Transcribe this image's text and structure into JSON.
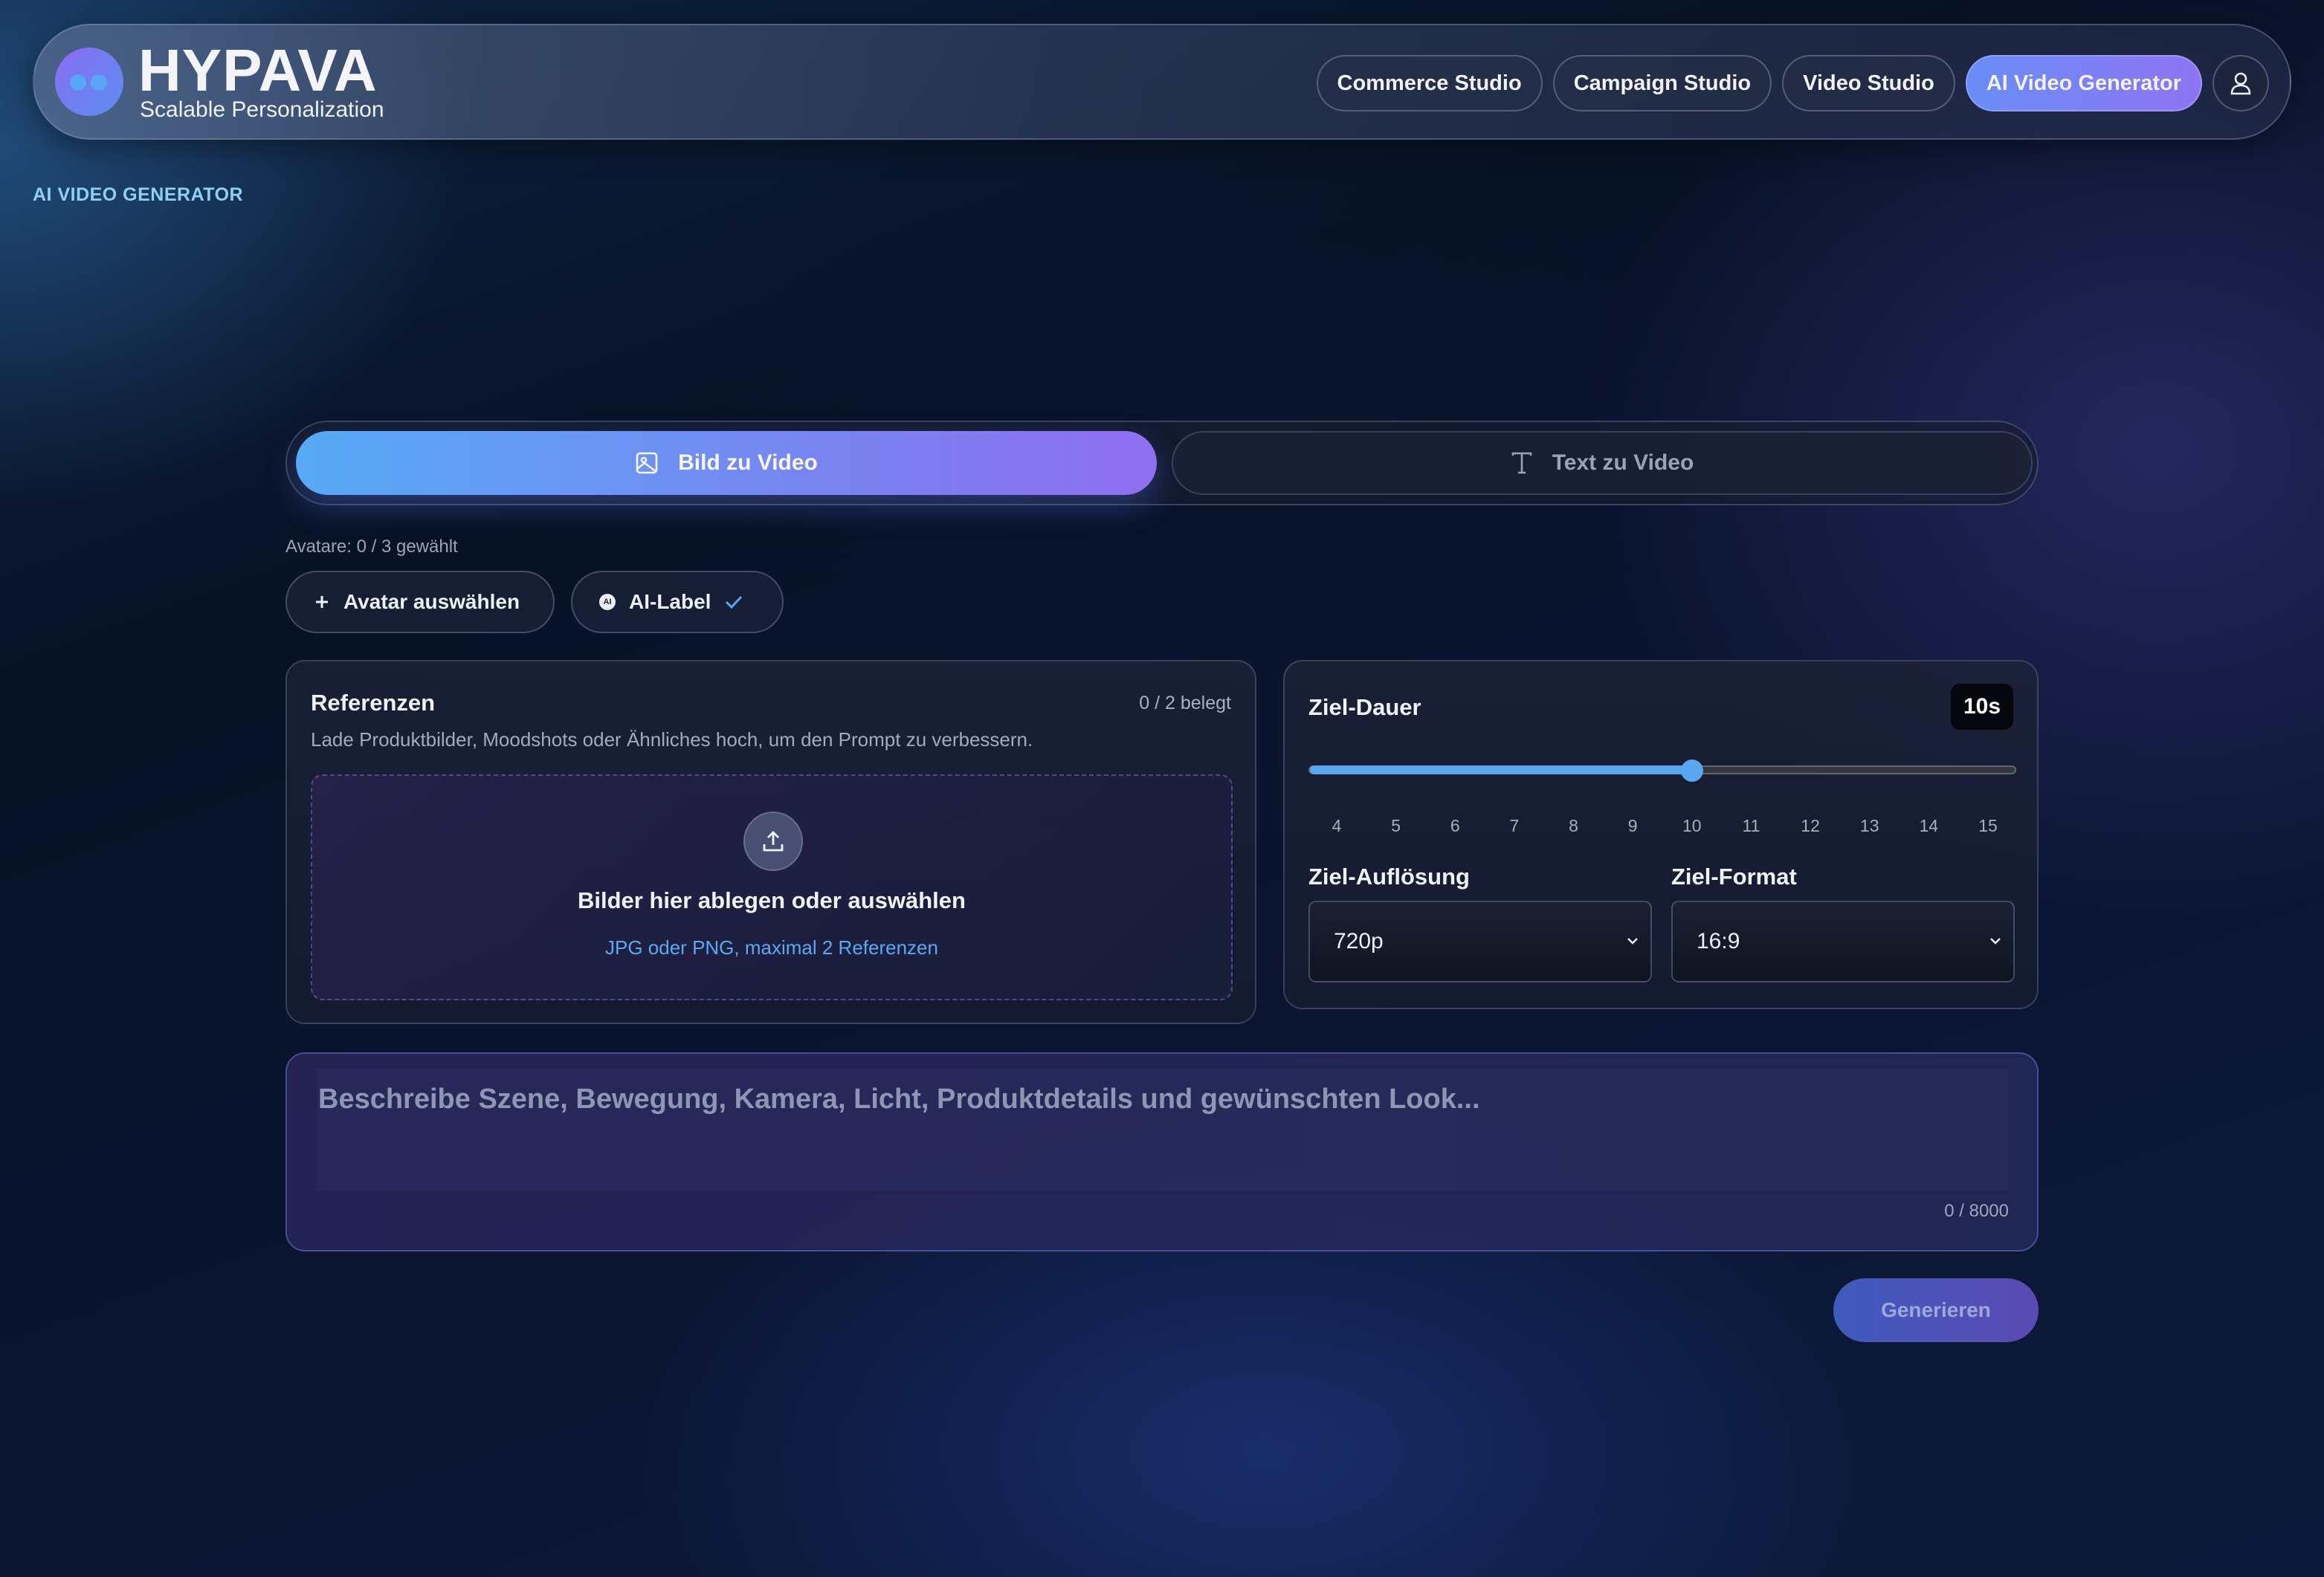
{
  "brand": {
    "name": "HYPAVA",
    "tagline": "Scalable Personalization"
  },
  "nav": {
    "items": [
      {
        "label": "Commerce Studio",
        "active": false
      },
      {
        "label": "Campaign Studio",
        "active": false
      },
      {
        "label": "Video Studio",
        "active": false
      },
      {
        "label": "AI Video Generator",
        "active": true
      }
    ],
    "user_icon": "user-icon"
  },
  "section_label": "AI VIDEO GENERATOR",
  "mode_tabs": [
    {
      "label": "Bild zu Video",
      "icon": "image-icon",
      "active": true
    },
    {
      "label": "Text zu Video",
      "icon": "text-icon",
      "active": false
    }
  ],
  "avatars": {
    "status": "Avatare: 0 / 3 gewählt",
    "select_label": "Avatar auswählen",
    "ai_label": "AI-Label",
    "ai_label_checked": true
  },
  "references": {
    "title": "Referenzen",
    "count": "0 / 2 belegt",
    "description": "Lade Produktbilder, Moodshots oder Ähnliches hoch, um den Prompt zu verbessern.",
    "drop_title": "Bilder hier ablegen oder auswählen",
    "drop_hint": "JPG oder PNG, maximal 2 Referenzen"
  },
  "duration": {
    "title": "Ziel-Dauer",
    "badge": "10s",
    "value": 10,
    "min": 4,
    "max": 15,
    "ticks": [
      "4",
      "5",
      "6",
      "7",
      "8",
      "9",
      "10",
      "11",
      "12",
      "13",
      "14",
      "15"
    ]
  },
  "resolution": {
    "title": "Ziel-Auflösung",
    "value": "720p"
  },
  "format": {
    "title": "Ziel-Format",
    "value": "16:9"
  },
  "prompt": {
    "placeholder": "Beschreibe Szene, Bewegung, Kamera, Licht, Produktdetails und gewünschten Look...",
    "count": "0 / 8000"
  },
  "generate_label": "Generieren",
  "colors": {
    "accent_blue": "#5aa6f0",
    "accent_purple": "#8e74f2",
    "section_label": "#8fd0f2"
  }
}
